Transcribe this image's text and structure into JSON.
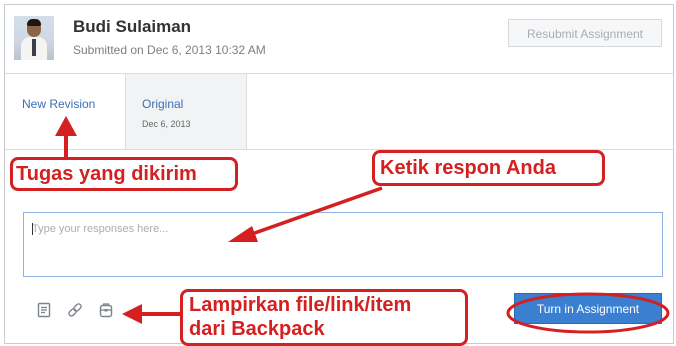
{
  "header": {
    "user_name": "Budi Sulaiman",
    "submitted_text": "Submitted on Dec 6, 2013 10:32 AM",
    "resubmit_label": "Resubmit Assignment"
  },
  "tabs": [
    {
      "label": "New Revision",
      "date": "",
      "active": true
    },
    {
      "label": "Original",
      "date": "Dec 6, 2013",
      "active": false
    }
  ],
  "response": {
    "placeholder": "Type your responses here...",
    "value": ""
  },
  "attachments": {
    "icons": [
      "file-icon",
      "link-icon",
      "backpack-icon"
    ]
  },
  "actions": {
    "turn_in_label": "Turn in Assignment"
  },
  "annotations": {
    "submitted_task": "Tugas yang dikirim",
    "type_response": "Ketik respon Anda",
    "attach_line1": "Lampirkan file/link/item",
    "attach_line2": "dari Backpack"
  },
  "colors": {
    "accent": "#3b7fd0",
    "link": "#3d6fb4",
    "annotation": "#d42020",
    "input_border": "#8fb2de"
  }
}
